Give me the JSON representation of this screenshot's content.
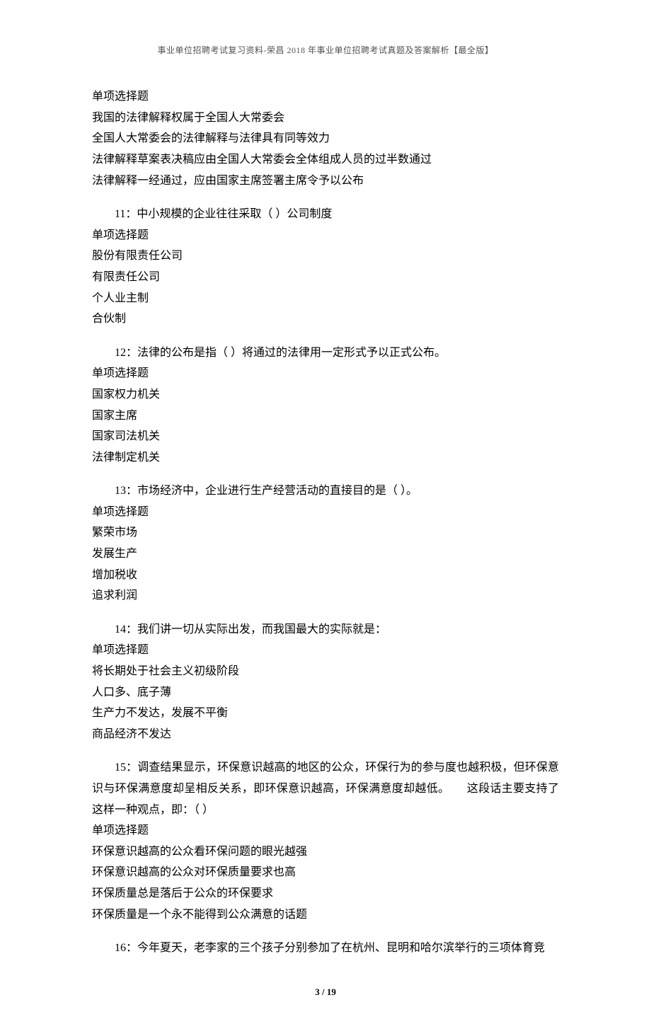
{
  "header": "事业单位招聘考试复习资料-荣昌 2018 年事业单位招聘考试真题及答案解析【最全版】",
  "q10_continuation": {
    "type": "单项选择题",
    "options": [
      "我国的法律解释权属于全国人大常委会",
      "全国人大常委会的法律解释与法律具有同等效力",
      "法律解释草案表决稿应由全国人大常委会全体组成人员的过半数通过",
      "法律解释一经通过，应由国家主席签署主席令予以公布"
    ]
  },
  "questions": [
    {
      "number": "11：",
      "text": "中小规模的企业往往采取（ ）公司制度",
      "type": "单项选择题",
      "options": [
        "股份有限责任公司",
        "有限责任公司",
        "个人业主制",
        "合伙制"
      ]
    },
    {
      "number": "12：",
      "text": "法律的公布是指（  ）将通过的法律用一定形式予以正式公布。",
      "type": "单项选择题",
      "options": [
        "国家权力机关",
        "国家主席",
        "国家司法机关",
        "法律制定机关"
      ]
    },
    {
      "number": "13：",
      "text": "市场经济中，企业进行生产经营活动的直接目的是（ ）。",
      "type": "单项选择题",
      "options": [
        "繁荣市场",
        "发展生产",
        "增加税收",
        "追求利润"
      ]
    },
    {
      "number": "14：",
      "text": "我们讲一切从实际出发，而我国最大的实际就是：",
      "type": "单项选择题",
      "options": [
        "将长期处于社会主义初级阶段",
        "人口多、底子薄",
        "生产力不发达，发展不平衡",
        "商品经济不发达"
      ]
    },
    {
      "number": "15：",
      "text": "调查结果显示，环保意识越高的地区的公众，环保行为的参与度也越积极，但环保意识与环保满意度却呈相反关系，即环保意识越高，环保满意度却越低。　　这段话主要支持了这样一种观点，即：（  ）",
      "type": "单项选择题",
      "options": [
        "环保意识越高的公众看环保问题的眼光越强",
        "环保意识越高的公众对环保质量要求也高",
        "环保质量总是落后于公众的环保要求",
        "环保质量是一个永不能得到公众满意的话题"
      ]
    },
    {
      "number": "16：",
      "text": "今年夏天，老李家的三个孩子分别参加了在杭州、昆明和哈尔滨举行的三项体育竞",
      "type": "",
      "options": []
    }
  ],
  "footer": {
    "page": "3",
    "sep": " / ",
    "total": "19"
  }
}
